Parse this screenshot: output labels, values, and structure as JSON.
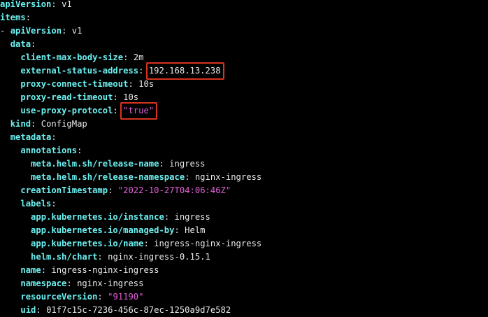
{
  "lines": [
    {
      "indent": "",
      "key": "apiVersion",
      "value": "v1",
      "kind": "plain"
    },
    {
      "indent": "",
      "key": "items",
      "value": "",
      "kind": "plain"
    },
    {
      "indent": "- ",
      "key": "apiVersion",
      "value": "v1",
      "kind": "plain"
    },
    {
      "indent": "  ",
      "key": "data",
      "value": "",
      "kind": "plain"
    },
    {
      "indent": "    ",
      "key": "client-max-body-size",
      "value": "2m",
      "kind": "plain"
    },
    {
      "indent": "    ",
      "key": "external-status-address",
      "value": "192.168.13.238",
      "kind": "plain",
      "highlight": true
    },
    {
      "indent": "    ",
      "key": "proxy-connect-timeout",
      "value": "10s",
      "kind": "plain"
    },
    {
      "indent": "    ",
      "key": "proxy-read-timeout",
      "value": "10s",
      "kind": "plain"
    },
    {
      "indent": "    ",
      "key": "use-proxy-protocol",
      "value": "\"true\"",
      "kind": "string",
      "highlight": true
    },
    {
      "indent": "  ",
      "key": "kind",
      "value": "ConfigMap",
      "kind": "plain"
    },
    {
      "indent": "  ",
      "key": "metadata",
      "value": "",
      "kind": "plain"
    },
    {
      "indent": "    ",
      "key": "annotations",
      "value": "",
      "kind": "plain"
    },
    {
      "indent": "      ",
      "key": "meta.helm.sh/release-name",
      "value": "ingress",
      "kind": "plain"
    },
    {
      "indent": "      ",
      "key": "meta.helm.sh/release-namespace",
      "value": "nginx-ingress",
      "kind": "plain"
    },
    {
      "indent": "    ",
      "key": "creationTimestamp",
      "value": "\"2022-10-27T04:06:46Z\"",
      "kind": "string"
    },
    {
      "indent": "    ",
      "key": "labels",
      "value": "",
      "kind": "plain"
    },
    {
      "indent": "      ",
      "key": "app.kubernetes.io/instance",
      "value": "ingress",
      "kind": "plain"
    },
    {
      "indent": "      ",
      "key": "app.kubernetes.io/managed-by",
      "value": "Helm",
      "kind": "plain"
    },
    {
      "indent": "      ",
      "key": "app.kubernetes.io/name",
      "value": "ingress-nginx-ingress",
      "kind": "plain"
    },
    {
      "indent": "      ",
      "key": "helm.sh/chart",
      "value": "nginx-ingress-0.15.1",
      "kind": "plain"
    },
    {
      "indent": "    ",
      "key": "name",
      "value": "ingress-nginx-ingress",
      "kind": "plain"
    },
    {
      "indent": "    ",
      "key": "namespace",
      "value": "nginx-ingress",
      "kind": "plain"
    },
    {
      "indent": "    ",
      "key": "resourceVersion",
      "value": "\"91190\"",
      "kind": "string"
    },
    {
      "indent": "    ",
      "key": "uid",
      "value": "01f7c15c-7236-456c-87ec-1250a9d7e582",
      "kind": "plain"
    }
  ],
  "colors": {
    "background": "#000000",
    "key": "#6cf0f0",
    "text": "#eaeaea",
    "string": "#e35fd6",
    "highlight_border": "#d8341f"
  }
}
